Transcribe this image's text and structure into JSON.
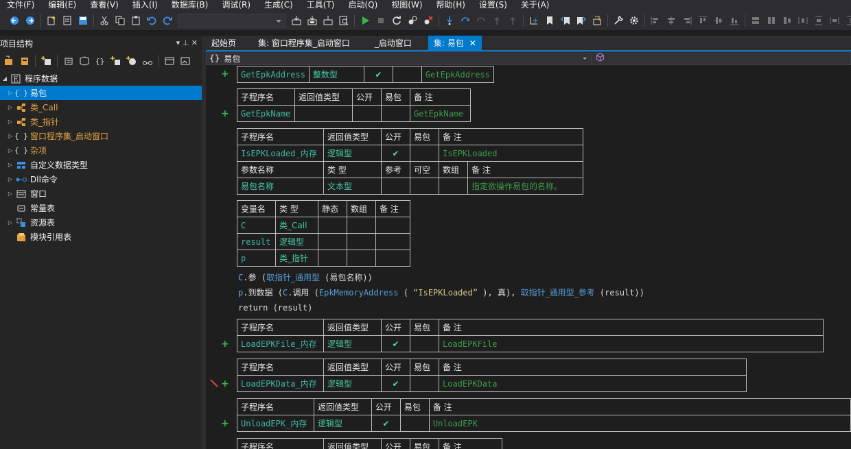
{
  "menu": [
    "文件(F)",
    "编辑(E)",
    "查看(V)",
    "插入(I)",
    "数据库(B)",
    "调试(R)",
    "生成(C)",
    "工具(T)",
    "启动(Q)",
    "视图(W)",
    "帮助(H)",
    "设置(S)",
    "关于(A)"
  ],
  "left_panel": {
    "title": "项目结构",
    "pin": "▾ ⊥ ✕",
    "tree": [
      {
        "label": "程序数据",
        "icon": "E",
        "level": 0,
        "expanded": true
      },
      {
        "label": "易包",
        "icon": "{}",
        "level": 1,
        "selected": true
      },
      {
        "label": "类_Call",
        "icon": "class",
        "level": 1,
        "orange": true
      },
      {
        "label": "类_指针",
        "icon": "class",
        "level": 1,
        "orange": true
      },
      {
        "label": "窗口程序集_启动窗口",
        "icon": "{}",
        "level": 1,
        "orange": true
      },
      {
        "label": "杂项",
        "icon": "{}",
        "level": 1,
        "orange": true
      },
      {
        "label": "自定义数据类型",
        "icon": "type",
        "level": 1
      },
      {
        "label": "Dll命令",
        "icon": "dll",
        "level": 1
      },
      {
        "label": "窗口",
        "icon": "win",
        "level": 1
      },
      {
        "label": "常量表",
        "icon": "const",
        "level": 1,
        "noarrow": true
      },
      {
        "label": "资源表",
        "icon": "res",
        "level": 1
      },
      {
        "label": "模块引用表",
        "icon": "mod",
        "level": 1,
        "noarrow": true
      }
    ]
  },
  "tabs": [
    {
      "label": "起始页",
      "active": false
    },
    {
      "label": "集: 窗口程序集_启动窗口",
      "active": false
    },
    {
      "label": "_启动窗口",
      "active": false
    },
    {
      "label": "集: 易包",
      "active": true,
      "close": "✕"
    }
  ],
  "navbar": {
    "scope_icon": "{}",
    "scope": "易包"
  },
  "editor": {
    "row1": {
      "name": "GetEpkAddress",
      "type": "整数型",
      "public": "✔",
      "comment": "GetEpkAddress"
    },
    "hdr": {
      "sub": "子程序名",
      "ret": "返回值类型",
      "pub": "公开",
      "epk": "易包",
      "note": "备 注"
    },
    "hdr_param": {
      "name": "参数名称",
      "type": "类 型",
      "ref": "参考",
      "opt": "可空",
      "arr": "数组",
      "note": "备 注"
    },
    "hdr_var": {
      "name": "变量名",
      "type": "类 型",
      "static": "静态",
      "arr": "数组",
      "note": "备 注"
    },
    "sub2": {
      "name": "GetEpkName",
      "comment": "GetEpkName"
    },
    "sub3": {
      "name": "IsEPKLoaded_内存",
      "type": "逻辑型",
      "public": "✔",
      "comment": "IsEPKLoaded"
    },
    "param3": {
      "name": "易包名称",
      "type": "文本型",
      "note": "指定欲操作易包的名称。"
    },
    "vars": [
      {
        "name": "C",
        "type": "类_Call"
      },
      {
        "name": "result",
        "type": "逻辑型"
      },
      {
        "name": "p",
        "type": "类_指针"
      }
    ],
    "code": {
      "l1": {
        "obj": "C",
        "dot": ".",
        "m": "参",
        "open": " (",
        "fn": "取指针_通用型",
        "args": " (易包名称))"
      },
      "l2": {
        "obj": "p",
        "dot": ".",
        "m": "到数据",
        "a": " (",
        "obj2": "C",
        "dot2": ".",
        "m2": "调用",
        "b": " (",
        "fn": "EpkMemoryAddress",
        "c": " ( ",
        "str": "“IsEPKLoaded”",
        "d": " ), 真), ",
        "fn2": "取指针_通用型_参考",
        "e": " (result))"
      },
      "l3": {
        "kw": "return",
        "rest": " (result)"
      }
    },
    "sub4": {
      "name": "LoadEPKFile_内存",
      "type": "逻辑型",
      "public": "✔",
      "comment": "LoadEPKFile"
    },
    "sub5": {
      "name": "LoadEPKData_内存",
      "type": "逻辑型",
      "public": "✔",
      "comment": "LoadEPKData"
    },
    "sub6": {
      "name": "UnloadEPK_内存",
      "type": "逻辑型",
      "public": "✔",
      "comment": "UnloadEPK"
    },
    "plus": "+"
  }
}
